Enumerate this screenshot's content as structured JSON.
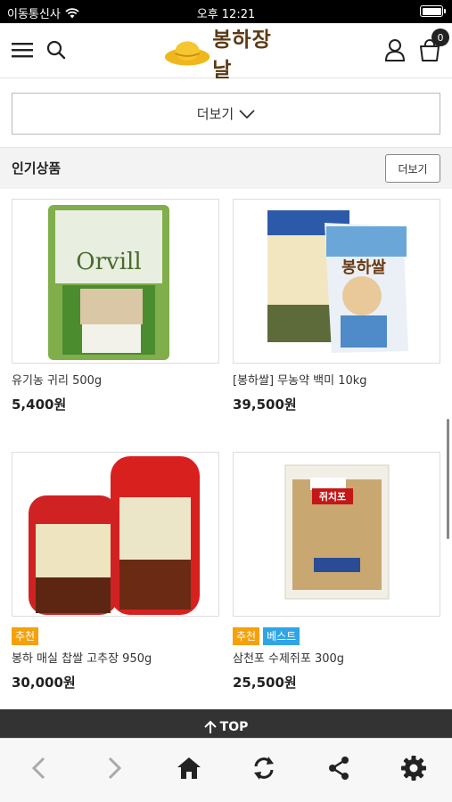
{
  "status_bar": {
    "carrier": "이동통신사",
    "time": "오후 12:21",
    "battery_level": 1.0
  },
  "header": {
    "logo_text": "봉하장날",
    "cart_count": "0",
    "icons": [
      "hamburger-menu-icon",
      "search-icon",
      "user-icon",
      "cart-icon"
    ]
  },
  "more_button": {
    "label": "더보기"
  },
  "popular": {
    "title": "인기상품",
    "more_label": "더보기",
    "products": [
      {
        "name": "유기농 귀리 500g",
        "price": "5,400원",
        "tags": [],
        "image_text": "Orvill"
      },
      {
        "name": "[봉하쌀] 무농약 백미 10kg",
        "price": "39,500원",
        "tags": [],
        "image_text": "봉하쌀"
      },
      {
        "name": "봉하 매실 찹쌀 고추장 950g",
        "price": "30,000원",
        "tags": [
          "추천"
        ]
      },
      {
        "name": "삼천포 수제쥐포 300g",
        "price": "25,500원",
        "tags": [
          "추천",
          "베스트"
        ],
        "image_text": "쥐치포"
      }
    ]
  },
  "top_button": {
    "label": "TOP"
  },
  "bottom_nav": {
    "items": [
      "back-arrow-icon",
      "forward-arrow-icon",
      "home-icon",
      "refresh-icon",
      "share-icon",
      "settings-gear-icon"
    ]
  },
  "colors": {
    "tag_recommend": "#f5a10a",
    "tag_best": "#2fa5e6",
    "top_bar": "#333333",
    "logo_brand": "#5c3a14"
  }
}
